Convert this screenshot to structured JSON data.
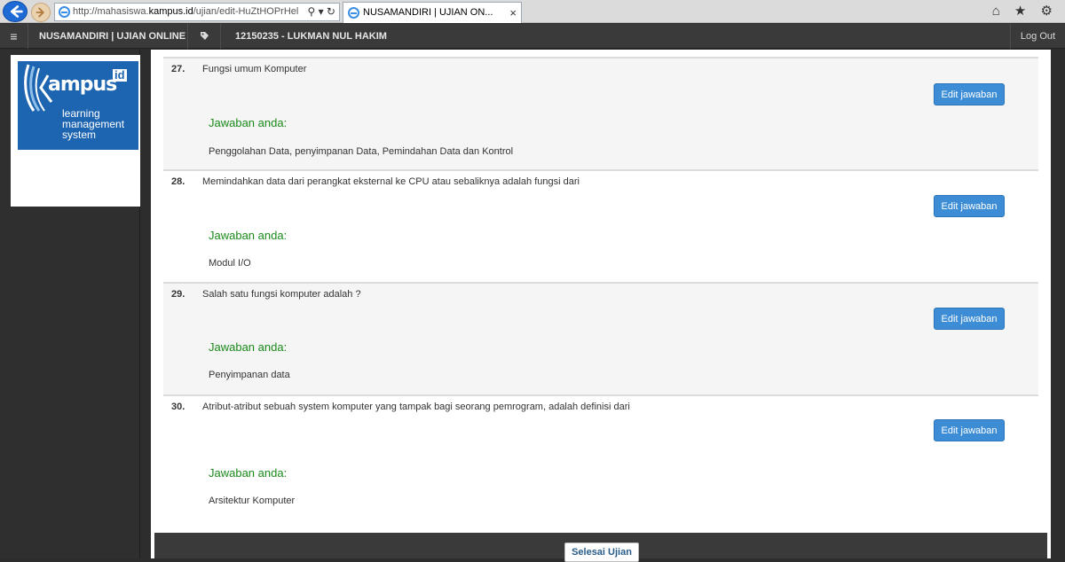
{
  "browser": {
    "url_prefix": "http://mahasiswa.",
    "url_domain": "kampus.id",
    "url_path": "/ujian/edit-HuZtHOPrHel",
    "tab_title": "NUSAMANDIRI | UJIAN ON...",
    "tab_close": "×",
    "address_tools": "⚲ ▾ ↻",
    "icons": "⌂ ★ ⚙"
  },
  "navbar": {
    "menu_icon": "≡",
    "brand": "NUSAMANDIRI | UJIAN ONLINE",
    "tag_icon": "🏷",
    "user": "12150235 - LUKMAN NUL HAKIM",
    "logout": "Log Out"
  },
  "logo": {
    "word": "ampus",
    "id": "id",
    "tag1": "learning",
    "tag2": "management",
    "tag3": "system"
  },
  "questions": [
    {
      "number": "27.",
      "text": "Fungsi umum Komputer",
      "answer_label": "Jawaban anda:",
      "answer": "Penggolahan Data, penyimpanan Data, Pemindahan Data dan Kontrol",
      "edit_label": "Edit jawaban"
    },
    {
      "number": "28.",
      "text": "Memindahkan data dari perangkat eksternal ke CPU atau sebaliknya adalah fungsi dari",
      "answer_label": "Jawaban anda:",
      "answer": "Modul I/O",
      "edit_label": "Edit jawaban"
    },
    {
      "number": "29.",
      "text": "Salah satu fungsi komputer adalah ?",
      "answer_label": "Jawaban anda:",
      "answer": "Penyimpanan data",
      "edit_label": "Edit jawaban"
    },
    {
      "number": "30.",
      "text": "Atribut-atribut sebuah system komputer yang tampak bagi seorang pemrogram, adalah definisi dari",
      "answer_label": "Jawaban anda:",
      "answer": "Arsitektur Komputer",
      "edit_label": "Edit jawaban"
    }
  ],
  "footer": {
    "finish_label": "Selesai Ujian"
  },
  "colors": {
    "accent": "#3c8dd6",
    "answer_label": "#1a8a1a",
    "navbar": "#3a3a3a"
  }
}
